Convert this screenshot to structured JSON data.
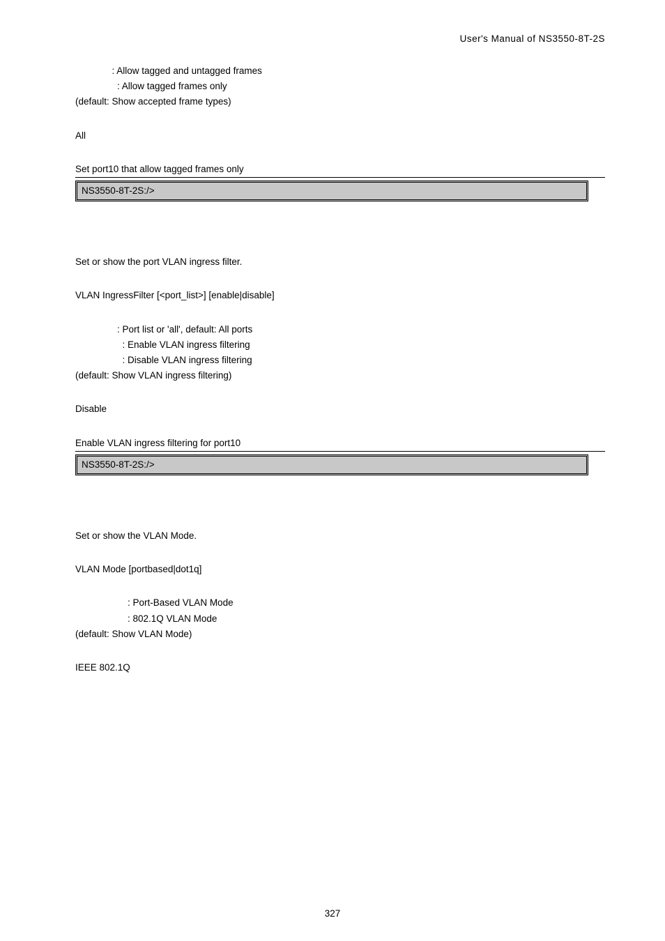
{
  "header": {
    "text": "User's  Manual  of  NS3550-8T-2S"
  },
  "frametype": {
    "line1": "              : Allow tagged and untagged frames",
    "line2": "                : Allow tagged frames only",
    "line3": "(default: Show accepted frame types)",
    "default_setting": "All",
    "example_label": "Set port10 that allow tagged frames only",
    "prompt": "NS3550-8T-2S:/>"
  },
  "ingress": {
    "desc": "Set or show the port VLAN ingress filter.",
    "syntax": "VLAN IngressFilter [<port_list>] [enable|disable]",
    "p1": "                : Port list or 'all', default: All ports",
    "p2": "                  : Enable VLAN ingress filtering",
    "p3": "                  : Disable VLAN ingress filtering",
    "p4": "(default: Show VLAN ingress filtering)",
    "default_setting": "Disable",
    "example_label": "Enable VLAN ingress filtering for port10",
    "prompt": "NS3550-8T-2S:/>"
  },
  "mode": {
    "desc": "Set or show the VLAN Mode.",
    "syntax": "VLAN Mode [portbased|dot1q]",
    "p1": "                    : Port-Based VLAN Mode",
    "p2": "                    : 802.1Q VLAN Mode",
    "p3": "(default: Show VLAN Mode)",
    "default_setting": "IEEE 802.1Q"
  },
  "footer": {
    "page": "327"
  }
}
